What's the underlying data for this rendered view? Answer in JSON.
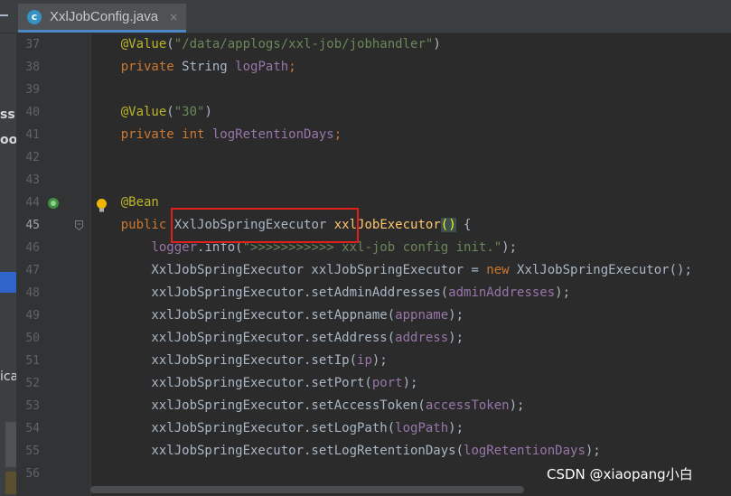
{
  "tab": {
    "label": "XxlJobConfig.java",
    "icon_letter": "c",
    "close_symbol": "×"
  },
  "left_panel": {
    "fragment_1": "ss",
    "fragment_2": "oo",
    "fragment_3": "ica"
  },
  "lines": [
    {
      "number": "37",
      "tokens": [
        {
          "t": "    ",
          "c": "plain"
        },
        {
          "t": "@Value",
          "c": "ann"
        },
        {
          "t": "(",
          "c": "plain"
        },
        {
          "t": "\"/data/applogs/xxl-job/jobhandler\"",
          "c": "str"
        },
        {
          "t": ")",
          "c": "plain"
        }
      ]
    },
    {
      "number": "38",
      "tokens": [
        {
          "t": "    ",
          "c": "plain"
        },
        {
          "t": "private ",
          "c": "kw"
        },
        {
          "t": "String ",
          "c": "plain"
        },
        {
          "t": "logPath",
          "c": "fld"
        },
        {
          "t": ";",
          "c": "kw"
        }
      ]
    },
    {
      "number": "39",
      "tokens": []
    },
    {
      "number": "40",
      "tokens": [
        {
          "t": "    ",
          "c": "plain"
        },
        {
          "t": "@Value",
          "c": "ann"
        },
        {
          "t": "(",
          "c": "plain"
        },
        {
          "t": "\"30\"",
          "c": "str"
        },
        {
          "t": ")",
          "c": "plain"
        }
      ]
    },
    {
      "number": "41",
      "tokens": [
        {
          "t": "    ",
          "c": "plain"
        },
        {
          "t": "private ",
          "c": "kw"
        },
        {
          "t": "int ",
          "c": "kw"
        },
        {
          "t": "logRetentionDays",
          "c": "fld"
        },
        {
          "t": ";",
          "c": "kw"
        }
      ]
    },
    {
      "number": "42",
      "tokens": []
    },
    {
      "number": "43",
      "tokens": []
    },
    {
      "number": "44",
      "tokens": [
        {
          "t": "    ",
          "c": "plain"
        },
        {
          "t": "@Bean",
          "c": "ann"
        }
      ]
    },
    {
      "number": "45",
      "current": true,
      "tokens": [
        {
          "t": "    ",
          "c": "plain"
        },
        {
          "t": "public ",
          "c": "kw"
        },
        {
          "t": "XxlJobSpringExecutor ",
          "c": "plain"
        },
        {
          "t": "xxlJobExecutor",
          "c": "fn"
        },
        {
          "t": "()",
          "c": "paren-hl"
        },
        {
          "t": " {",
          "c": "plain"
        }
      ]
    },
    {
      "number": "46",
      "tokens": [
        {
          "t": "        ",
          "c": "plain"
        },
        {
          "t": "logger",
          "c": "fld"
        },
        {
          "t": ".info(",
          "c": "plain"
        },
        {
          "t": "\">>>>>>>>>>> xxl-job config init.\"",
          "c": "str"
        },
        {
          "t": ");",
          "c": "plain"
        }
      ]
    },
    {
      "number": "47",
      "tokens": [
        {
          "t": "        XxlJobSpringExecutor xxlJobSpringExecutor = ",
          "c": "plain"
        },
        {
          "t": "new ",
          "c": "kw"
        },
        {
          "t": "XxlJobSpringExecutor();",
          "c": "plain"
        }
      ]
    },
    {
      "number": "48",
      "tokens": [
        {
          "t": "        xxlJobSpringExecutor.setAdminAddresses(",
          "c": "plain"
        },
        {
          "t": "adminAddresses",
          "c": "fld"
        },
        {
          "t": ");",
          "c": "plain"
        }
      ]
    },
    {
      "number": "49",
      "tokens": [
        {
          "t": "        xxlJobSpringExecutor.setAppname(",
          "c": "plain"
        },
        {
          "t": "appname",
          "c": "fld"
        },
        {
          "t": ");",
          "c": "plain"
        }
      ]
    },
    {
      "number": "50",
      "tokens": [
        {
          "t": "        xxlJobSpringExecutor.setAddress(",
          "c": "plain"
        },
        {
          "t": "address",
          "c": "fld"
        },
        {
          "t": ");",
          "c": "plain"
        }
      ]
    },
    {
      "number": "51",
      "tokens": [
        {
          "t": "        xxlJobSpringExecutor.setIp(",
          "c": "plain"
        },
        {
          "t": "ip",
          "c": "fld"
        },
        {
          "t": ");",
          "c": "plain"
        }
      ]
    },
    {
      "number": "52",
      "tokens": [
        {
          "t": "        xxlJobSpringExecutor.setPort(",
          "c": "plain"
        },
        {
          "t": "port",
          "c": "fld"
        },
        {
          "t": ");",
          "c": "plain"
        }
      ]
    },
    {
      "number": "53",
      "tokens": [
        {
          "t": "        xxlJobSpringExecutor.setAccessToken(",
          "c": "plain"
        },
        {
          "t": "accessToken",
          "c": "fld"
        },
        {
          "t": ");",
          "c": "plain"
        }
      ]
    },
    {
      "number": "54",
      "tokens": [
        {
          "t": "        xxlJobSpringExecutor.setLogPath(",
          "c": "plain"
        },
        {
          "t": "logPath",
          "c": "fld"
        },
        {
          "t": ");",
          "c": "plain"
        }
      ]
    },
    {
      "number": "55",
      "tokens": [
        {
          "t": "        xxlJobSpringExecutor.setLogRetentionDays(",
          "c": "plain"
        },
        {
          "t": "logRetentionDays",
          "c": "fld"
        },
        {
          "t": ");",
          "c": "plain"
        }
      ]
    },
    {
      "number": "56",
      "tokens": []
    }
  ],
  "watermark": "CSDN @xiaopang小白",
  "colors": {
    "keyword": "#cc7832",
    "annotation": "#bbb529",
    "string": "#6a8759",
    "field": "#9876aa",
    "method": "#ffc66d",
    "highlight_box": "#e0201a"
  }
}
